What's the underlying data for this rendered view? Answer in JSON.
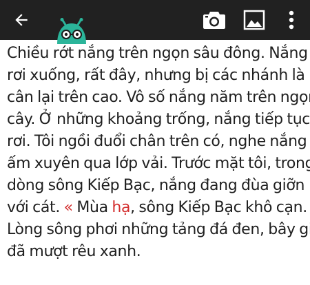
{
  "toolbar": {
    "icons": {
      "back": "arrow-left-icon",
      "camera": "camera-icon",
      "image": "image-icon",
      "more": "more-vert-icon"
    },
    "background_color": "#212121",
    "icon_color": "#ffffff"
  },
  "mascot": {
    "icon": "robot-mascot-icon",
    "color": "#2bb59a"
  },
  "content": {
    "text_color": "#202020",
    "accent_color": "#d32f2f",
    "lines": [
      "Chiều rớt nắng trên ngọn sâu đông. Nắng",
      "rơi xuống, rất đây, nhưng bị các nhánh là",
      "cân lại trên cao. Vô số nắng năm trên ngọn",
      "cây. Ở những khoảng trống, nắng tiếp tục",
      "rơi. Tôi ngồi đuổi chân trên có, nghe nắng",
      "ấm xuyên qua lớp vải. Trước mặt tôi, trong",
      "dòng sông Kiếp Bạc, nắng đang đùa giỡn"
    ],
    "line8": {
      "before": "với cát. ",
      "quote": "«",
      "middle": " Mùa ",
      "highlight": "hạ",
      "after": ", sông Kiếp Bạc khô cạn."
    },
    "lines_end": [
      "Lòng sông phơi những tảng đá đen, bây giờ",
      "đã mượt rêu xanh."
    ]
  }
}
